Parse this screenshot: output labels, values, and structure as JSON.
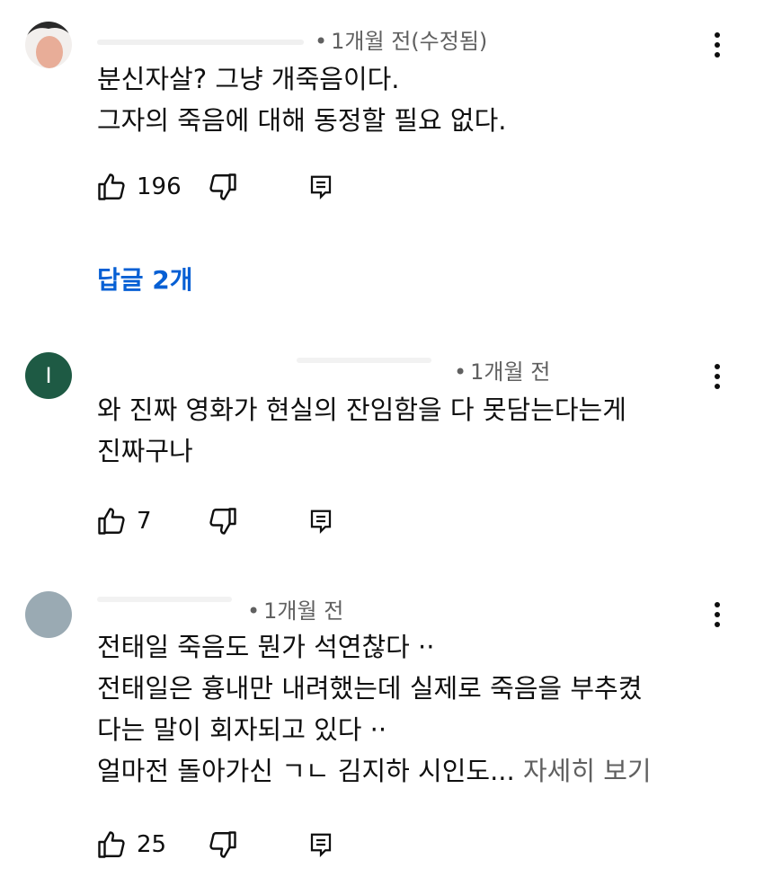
{
  "comments": [
    {
      "time": "1개월 전(수정됨)",
      "lines": [
        "분신자살? 그냥 개죽음이다.",
        "그자의 죽음에 대해 동정할 필요 없다."
      ],
      "likes": "196",
      "replies_label": "답글 2개"
    },
    {
      "avatar_letter": "I",
      "avatar_color": "#1e5a44",
      "time": "1개월 전",
      "lines": [
        "와 진짜 영화가 현실의 잔임함을 다 못담는다는게",
        "진짜구나"
      ],
      "likes": "7"
    },
    {
      "avatar_color": "#9aaab3",
      "time": "1개월 전",
      "lines": [
        "전태일 죽음도 뭔가 석연찮다 ··",
        "전태일은 흉내만 내려했는데 실제로 죽음을 부추켰",
        "다는 말이 회자되고 있다 ··",
        "얼마전 돌아가신 ㄱㄴ 김지하 시인도..."
      ],
      "more_label": " 자세히 보기",
      "likes": "25"
    }
  ],
  "icons": {
    "like": "thumbs-up-icon",
    "dislike": "thumbs-down-icon",
    "reply": "reply-icon",
    "more": "more-vert-icon"
  },
  "colors": {
    "link": "#065fd4",
    "meta": "#606060",
    "text": "#0f0f0f"
  }
}
